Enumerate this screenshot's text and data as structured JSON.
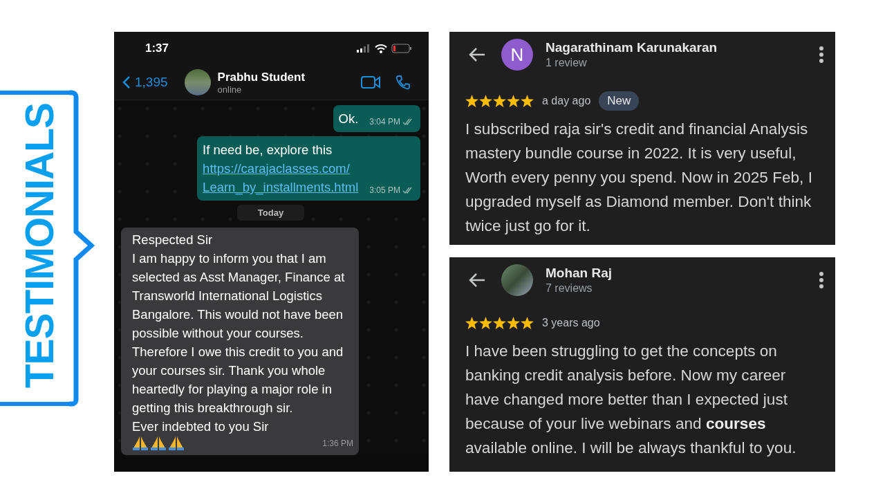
{
  "banner": {
    "title": "TESTIMONIALS"
  },
  "chat": {
    "status_bar": {
      "time": "1:37"
    },
    "header": {
      "back_count": "1,395",
      "contact_name": "Prabhu Student",
      "status": "online"
    },
    "messages": [
      {
        "kind": "outgoing",
        "text": "Ok.",
        "time": "3:04 PM"
      },
      {
        "kind": "outgoing",
        "text": "If need be, explore this",
        "link_lines": [
          "https://carajaclasses.com/",
          "Learn_by_installments.html"
        ],
        "time": "3:05 PM"
      },
      {
        "kind": "date",
        "text": "Today"
      },
      {
        "kind": "incoming",
        "text": "Respected Sir\nI am happy to inform you that I am selected as Asst Manager, Finance at Transworld International Logistics Bangalore. This would not have been possible without your courses. Therefore I owe this credit to you and your courses sir. Thank you whole heartedly for playing a major role in getting this breakthrough sir.\nEver indebted to you Sir",
        "time": "1:36 PM"
      }
    ]
  },
  "reviews": [
    {
      "name": "Nagarathinam Karunakaran",
      "review_count": "1 review",
      "avatar": {
        "kind": "letter",
        "letter": "N",
        "color": "#8e5ccd"
      },
      "stars": 5,
      "time": "a day ago",
      "badge": "New",
      "text": "I subscribed raja sir's credit and financial Analysis mastery bundle course in 2022. It is very useful, Worth every penny you spend. Now in 2025 Feb, I upgraded myself as Diamond member. Don't think twice just go for it."
    },
    {
      "name": "Mohan Raj",
      "review_count": "7 reviews",
      "avatar": {
        "kind": "photo"
      },
      "stars": 5,
      "time": "3 years ago",
      "text": "I have been struggling to get the concepts on banking credit analysis before. Now my career have changed more better than I expected just because of your live webinars and **courses** available online. I will be always thankful to you."
    }
  ]
}
